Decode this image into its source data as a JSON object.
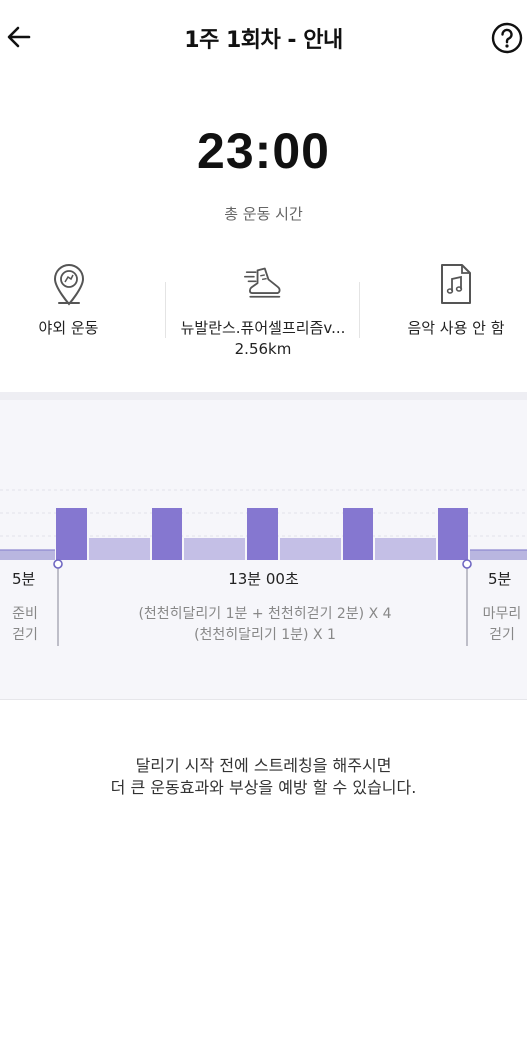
{
  "header": {
    "title": "1주 1회차 - 안내",
    "back_icon": "arrow-left-icon",
    "help_icon": "question-circle-icon"
  },
  "summary": {
    "total_time": "23:00",
    "total_time_label": "총 운동 시간"
  },
  "info": [
    {
      "icon": "outdoor-location-icon",
      "label": "야외 운동"
    },
    {
      "icon": "running-shoe-icon",
      "label": "뉴발란스.퓨어셀프리즘v...",
      "sub": "2.56km"
    },
    {
      "icon": "music-file-icon",
      "label": "음악 사용 안 함"
    }
  ],
  "plan": {
    "warmup": {
      "time": "5분",
      "label_line1": "준비",
      "label_line2": "걷기"
    },
    "main": {
      "time": "13분 00초",
      "line1": "(천천히달리기 1분 + 천천히걷기 2분) X 4",
      "line2": "(천천히달리기 1분) X 1"
    },
    "cooldown": {
      "time": "5분",
      "label_line1": "마무리",
      "label_line2": "걷기"
    }
  },
  "chart_data": {
    "type": "bar",
    "segments": [
      {
        "kind": "walk",
        "minutes": 5
      },
      {
        "kind": "run",
        "minutes": 1
      },
      {
        "kind": "walk",
        "minutes": 2
      },
      {
        "kind": "run",
        "minutes": 1
      },
      {
        "kind": "walk",
        "minutes": 2
      },
      {
        "kind": "run",
        "minutes": 1
      },
      {
        "kind": "walk",
        "minutes": 2
      },
      {
        "kind": "run",
        "minutes": 1
      },
      {
        "kind": "walk",
        "minutes": 2
      },
      {
        "kind": "run",
        "minutes": 1
      },
      {
        "kind": "walk",
        "minutes": 5
      }
    ],
    "colors": {
      "run": "#8577d0",
      "walk": "#c4bfe6",
      "warm": "#b9b6e0",
      "marker": "#6f67c2"
    }
  },
  "tip": {
    "line1": "달리기 시작 전에 스트레칭을 해주시면",
    "line2": "더 큰 운동효과와 부상을 예방 할 수 있습니다."
  }
}
